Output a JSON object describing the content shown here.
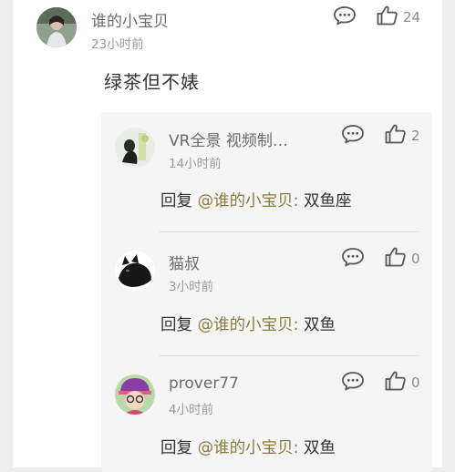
{
  "comment": {
    "username": "谁的小宝贝",
    "time": "23小时前",
    "likes": "24",
    "text": "绿茶但不婊",
    "icons": {
      "reply": "comment-bubble-icon",
      "like": "thumbs-up-icon"
    }
  },
  "replies": [
    {
      "username": "VR全景 视频制…",
      "time": "14小时前",
      "likes": "2",
      "prefix": "回复 ",
      "mention": "@谁的小宝贝",
      "separator": ": ",
      "text": "双鱼座"
    },
    {
      "username": "猫叔",
      "time": "3小时前",
      "likes": "0",
      "prefix": "回复 ",
      "mention": "@谁的小宝贝",
      "separator": ": ",
      "text": "双鱼"
    },
    {
      "username": "prover77",
      "time": "4小时前",
      "likes": "0",
      "prefix": "回复 ",
      "mention": "@谁的小宝贝",
      "separator": ": ",
      "text": "双鱼"
    }
  ],
  "colors": {
    "mention": "#8c7a3c",
    "username": "#6b6b6b",
    "background": "#eeeeee"
  }
}
